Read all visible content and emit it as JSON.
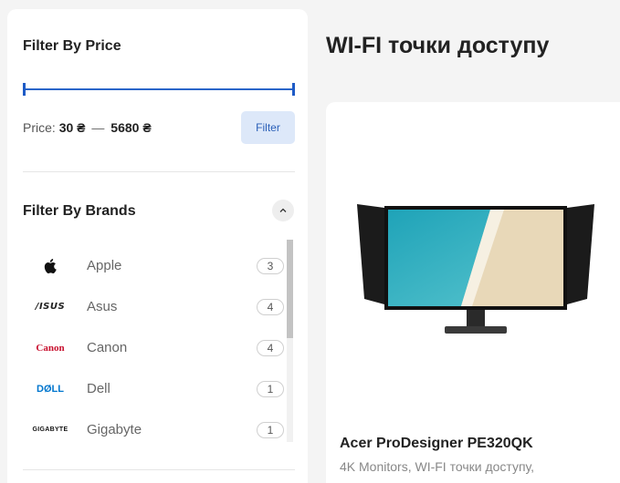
{
  "price_filter": {
    "title": "Filter By Price",
    "range": {
      "min": 30,
      "max": 5680
    },
    "price_label": "Price:",
    "min_text": "30 ₴",
    "separator": "—",
    "max_text": "5680 ₴",
    "button_label": "Filter"
  },
  "brand_filter": {
    "title": "Filter By Brands",
    "toggle_icon": "chevron-up-icon",
    "brands": [
      {
        "name": "Apple",
        "count": "3",
        "logo": "apple-logo"
      },
      {
        "name": "Asus",
        "count": "4",
        "logo": "asus-logo",
        "logo_text": "/ISUS"
      },
      {
        "name": "Canon",
        "count": "4",
        "logo": "canon-logo",
        "logo_text": "Canon"
      },
      {
        "name": "Dell",
        "count": "1",
        "logo": "dell-logo",
        "logo_text": "DØLL"
      },
      {
        "name": "Gigabyte",
        "count": "1",
        "logo": "gigabyte-logo",
        "logo_text": "GIGABYTE"
      }
    ]
  },
  "main": {
    "title_bold": "WI-FI",
    "title_rest": "точки доступу"
  },
  "product": {
    "name": "Acer ProDesigner PE320QK",
    "category_1": "4K Monitors",
    "category_sep": ", ",
    "category_2": "WI-FI точки доступу",
    "category_tail": ","
  },
  "colors": {
    "accent": "#2a66c9",
    "button_bg": "#dde8f9",
    "canon_red": "#c8102e",
    "dell_blue": "#0076ce"
  }
}
